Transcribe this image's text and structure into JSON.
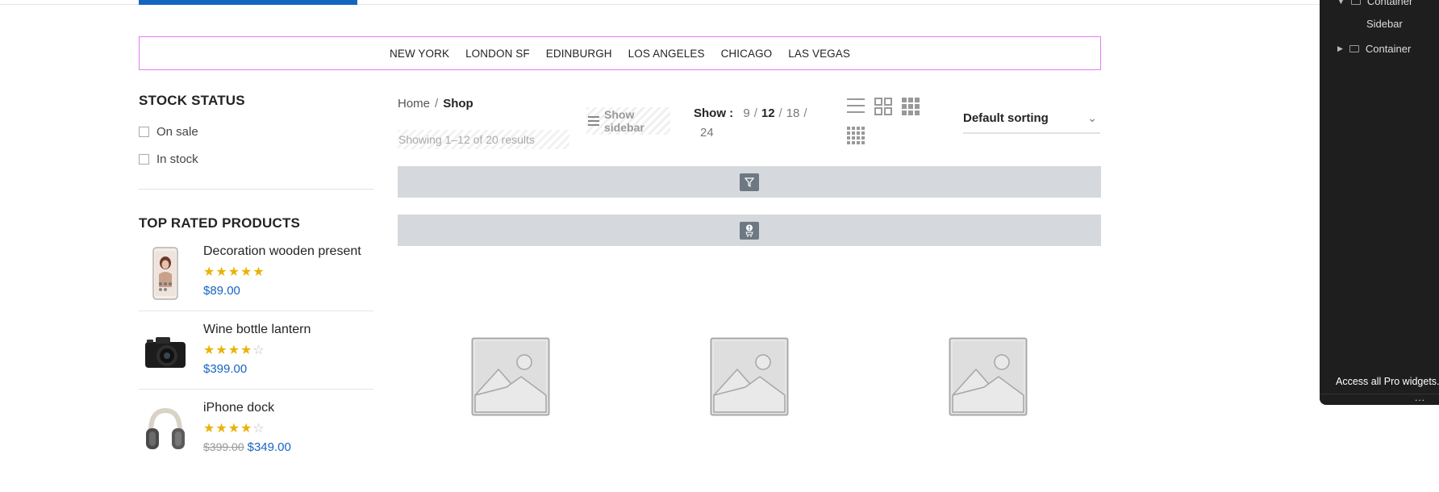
{
  "nav": {
    "cities": [
      "NEW YORK",
      "LONDON SF",
      "EDINBURGH",
      "LOS ANGELES",
      "CHICAGO",
      "LAS VEGAS"
    ]
  },
  "sidebar": {
    "stock_title": "STOCK STATUS",
    "stock_options": [
      "On sale",
      "In stock"
    ],
    "top_rated_title": "TOP RATED PRODUCTS",
    "products": [
      {
        "name": "Decoration wooden present",
        "rating": 5,
        "price": "$89.00",
        "old_price": ""
      },
      {
        "name": "Wine bottle lantern",
        "rating": 4,
        "price": "$399.00",
        "old_price": ""
      },
      {
        "name": "iPhone dock",
        "rating": 4,
        "price": "$349.00",
        "old_price": "$399.00"
      }
    ]
  },
  "breadcrumb": {
    "home": "Home",
    "separator": "/",
    "current": "Shop"
  },
  "results_text": "Showing 1–12 of 20 results",
  "show_sidebar_label": "Show sidebar",
  "per_page": {
    "label": "Show :",
    "options": [
      "9",
      "12",
      "18",
      "24"
    ],
    "active": "12"
  },
  "sorting": {
    "selected": "Default sorting"
  },
  "panel": {
    "items": [
      "Container",
      "Sidebar",
      "Container"
    ],
    "promo": "Access all Pro widgets.",
    "more": "..."
  },
  "colors": {
    "accent": "#1565c0",
    "star": "#eab307",
    "nav_outline": "#e27ef0",
    "panel_bg": "#1e1e1e"
  }
}
